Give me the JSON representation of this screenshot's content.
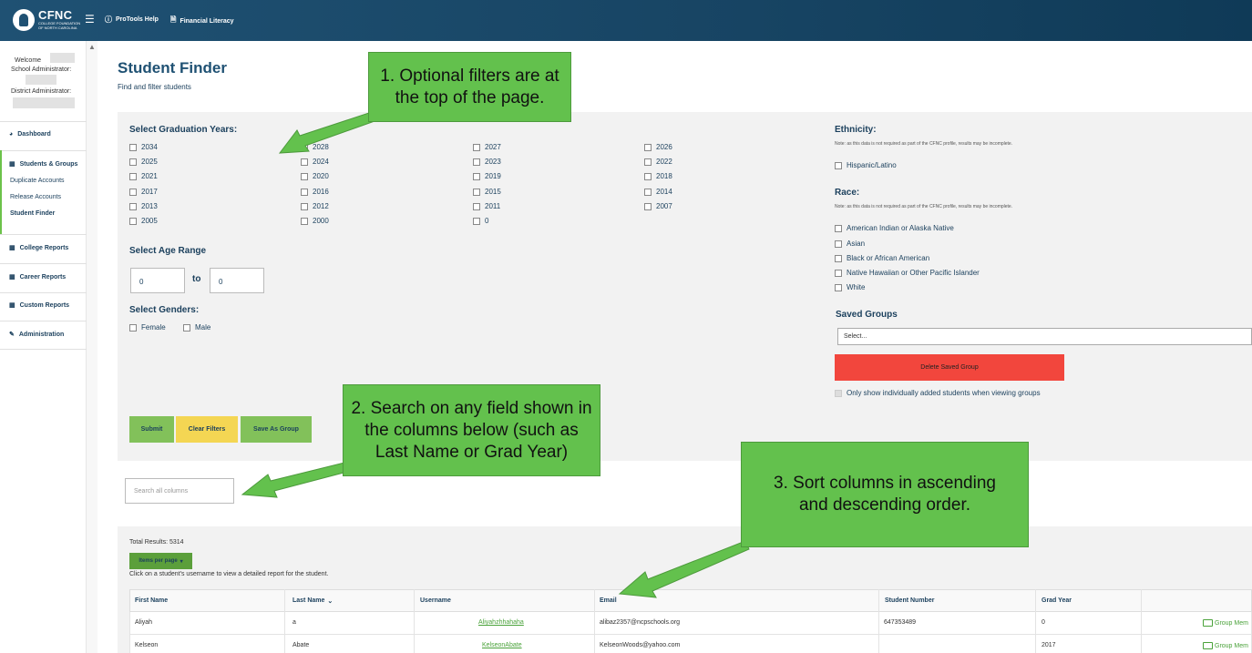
{
  "topbar": {
    "brand": "CFNC",
    "brand_sub": "COLLEGE FOUNDATION OF NORTH CAROLINA",
    "links": [
      {
        "label": "ProTools Help",
        "icon": "help-circle-icon"
      },
      {
        "label": "Financial Literacy",
        "icon": "document-icon"
      }
    ]
  },
  "sidebar": {
    "welcome": "Welcome",
    "school_admin": "School Administrator:",
    "district_admin": "District Administrator:",
    "items": {
      "dashboard": "Dashboard",
      "students_groups": "Students & Groups",
      "duplicate": "Duplicate Accounts",
      "release": "Release Accounts",
      "student_finder": "Student Finder",
      "college_reports": "College Reports",
      "career_reports": "Career Reports",
      "custom_reports": "Custom Reports",
      "administration": "Administration"
    }
  },
  "page": {
    "title": "Student Finder",
    "subtitle": "Find and filter students"
  },
  "filters": {
    "grad_years_label": "Select Graduation Years:",
    "grad_years": [
      "2034",
      "2028",
      "2027",
      "2026",
      "2025",
      "2024",
      "2023",
      "2022",
      "2021",
      "2020",
      "2019",
      "2018",
      "2017",
      "2016",
      "2015",
      "2014",
      "2013",
      "2012",
      "2011",
      "2007",
      "2005",
      "2000",
      "0"
    ],
    "age_label": "Select Age Range",
    "age_from": "0",
    "age_to": "0",
    "age_to_word": "to",
    "genders_label": "Select Genders:",
    "genders": [
      "Female",
      "Male"
    ],
    "ethnicity_label": "Ethnicity:",
    "ethnicity_note": "Note: as this data is not required as part of the CFNC profile, results may be incomplete.",
    "ethnicity_options": [
      "Hispanic/Latino"
    ],
    "race_label": "Race:",
    "race_note": "Note: as this data is not required as part of the CFNC profile, results may be incomplete.",
    "race_options": [
      "American Indian or Alaska Native",
      "Asian",
      "Black or African American",
      "Native Hawaiian or Other Pacific Islander",
      "White"
    ],
    "saved_groups_label": "Saved Groups",
    "saved_groups_value": "Select...",
    "delete_group": "Delete Saved Group",
    "only_show": "Only show individually added students when viewing groups",
    "submit": "Submit",
    "clear": "Clear Filters",
    "save_group": "Save As Group"
  },
  "search": {
    "placeholder": "Search all columns"
  },
  "results": {
    "total": "Total Results: 5314",
    "items_per_page": "Items per page",
    "hint": "Click on a student's username to view a detailed report for the student.",
    "columns": [
      "First Name",
      "Last Name",
      "Username",
      "Email",
      "Student Number",
      "Grad Year"
    ],
    "rows": [
      {
        "first": "Aliyah",
        "last": "a",
        "username": "Aliyahzhhahaha",
        "email": "alibaz2357@ncpschools.org",
        "number": "647353489",
        "grad": "0",
        "action": "Group Mem"
      },
      {
        "first": "Kelseon",
        "last": "Abate",
        "username": "KelseonAbate",
        "email": "KelseonWoods@yahoo.com",
        "number": "",
        "grad": "2017",
        "action": "Group Mem"
      }
    ]
  },
  "callouts": {
    "one": "1. Optional filters are at the top of the page.",
    "two": "2. Search on any field shown in the columns below (such as Last Name or Grad Year)",
    "three": "3. Sort columns in ascending and descending order."
  },
  "colors": {
    "topbar": "#1f5173",
    "callout": "#63c14d",
    "arrow": "#63c14d",
    "delete": "#f2463d",
    "clear": "#f4d653",
    "submit": "#82c15a"
  }
}
